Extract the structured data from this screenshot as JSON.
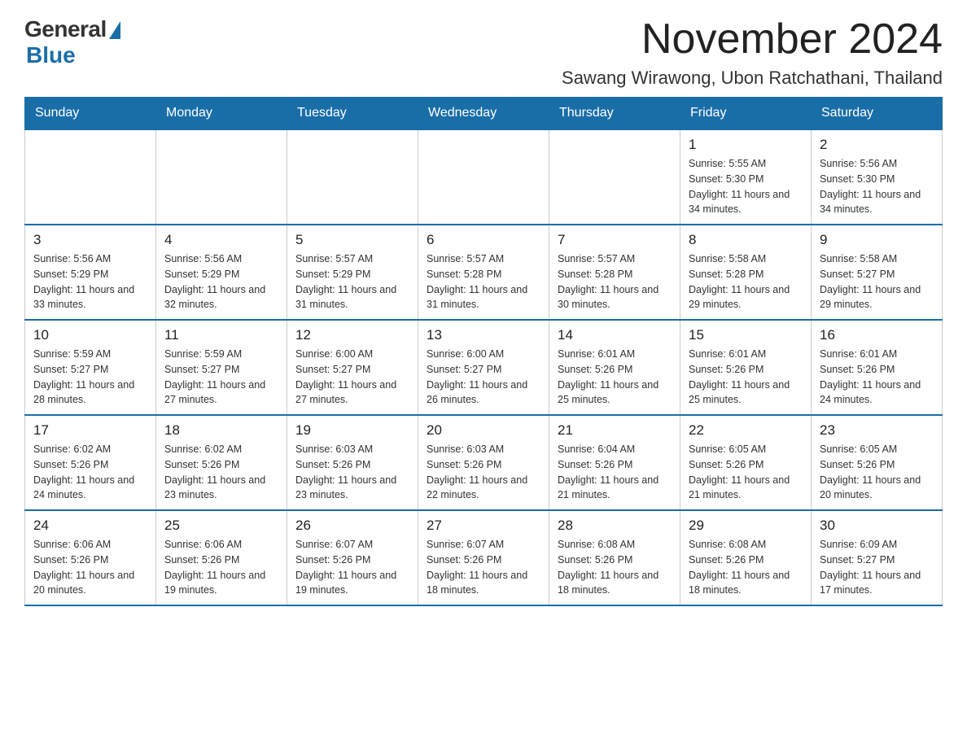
{
  "logo": {
    "general": "General",
    "blue": "Blue"
  },
  "title": "November 2024",
  "location": "Sawang Wirawong, Ubon Ratchathani, Thailand",
  "headers": [
    "Sunday",
    "Monday",
    "Tuesday",
    "Wednesday",
    "Thursday",
    "Friday",
    "Saturday"
  ],
  "weeks": [
    [
      {
        "day": "",
        "info": ""
      },
      {
        "day": "",
        "info": ""
      },
      {
        "day": "",
        "info": ""
      },
      {
        "day": "",
        "info": ""
      },
      {
        "day": "",
        "info": ""
      },
      {
        "day": "1",
        "info": "Sunrise: 5:55 AM\nSunset: 5:30 PM\nDaylight: 11 hours and 34 minutes."
      },
      {
        "day": "2",
        "info": "Sunrise: 5:56 AM\nSunset: 5:30 PM\nDaylight: 11 hours and 34 minutes."
      }
    ],
    [
      {
        "day": "3",
        "info": "Sunrise: 5:56 AM\nSunset: 5:29 PM\nDaylight: 11 hours and 33 minutes."
      },
      {
        "day": "4",
        "info": "Sunrise: 5:56 AM\nSunset: 5:29 PM\nDaylight: 11 hours and 32 minutes."
      },
      {
        "day": "5",
        "info": "Sunrise: 5:57 AM\nSunset: 5:29 PM\nDaylight: 11 hours and 31 minutes."
      },
      {
        "day": "6",
        "info": "Sunrise: 5:57 AM\nSunset: 5:28 PM\nDaylight: 11 hours and 31 minutes."
      },
      {
        "day": "7",
        "info": "Sunrise: 5:57 AM\nSunset: 5:28 PM\nDaylight: 11 hours and 30 minutes."
      },
      {
        "day": "8",
        "info": "Sunrise: 5:58 AM\nSunset: 5:28 PM\nDaylight: 11 hours and 29 minutes."
      },
      {
        "day": "9",
        "info": "Sunrise: 5:58 AM\nSunset: 5:27 PM\nDaylight: 11 hours and 29 minutes."
      }
    ],
    [
      {
        "day": "10",
        "info": "Sunrise: 5:59 AM\nSunset: 5:27 PM\nDaylight: 11 hours and 28 minutes."
      },
      {
        "day": "11",
        "info": "Sunrise: 5:59 AM\nSunset: 5:27 PM\nDaylight: 11 hours and 27 minutes."
      },
      {
        "day": "12",
        "info": "Sunrise: 6:00 AM\nSunset: 5:27 PM\nDaylight: 11 hours and 27 minutes."
      },
      {
        "day": "13",
        "info": "Sunrise: 6:00 AM\nSunset: 5:27 PM\nDaylight: 11 hours and 26 minutes."
      },
      {
        "day": "14",
        "info": "Sunrise: 6:01 AM\nSunset: 5:26 PM\nDaylight: 11 hours and 25 minutes."
      },
      {
        "day": "15",
        "info": "Sunrise: 6:01 AM\nSunset: 5:26 PM\nDaylight: 11 hours and 25 minutes."
      },
      {
        "day": "16",
        "info": "Sunrise: 6:01 AM\nSunset: 5:26 PM\nDaylight: 11 hours and 24 minutes."
      }
    ],
    [
      {
        "day": "17",
        "info": "Sunrise: 6:02 AM\nSunset: 5:26 PM\nDaylight: 11 hours and 24 minutes."
      },
      {
        "day": "18",
        "info": "Sunrise: 6:02 AM\nSunset: 5:26 PM\nDaylight: 11 hours and 23 minutes."
      },
      {
        "day": "19",
        "info": "Sunrise: 6:03 AM\nSunset: 5:26 PM\nDaylight: 11 hours and 23 minutes."
      },
      {
        "day": "20",
        "info": "Sunrise: 6:03 AM\nSunset: 5:26 PM\nDaylight: 11 hours and 22 minutes."
      },
      {
        "day": "21",
        "info": "Sunrise: 6:04 AM\nSunset: 5:26 PM\nDaylight: 11 hours and 21 minutes."
      },
      {
        "day": "22",
        "info": "Sunrise: 6:05 AM\nSunset: 5:26 PM\nDaylight: 11 hours and 21 minutes."
      },
      {
        "day": "23",
        "info": "Sunrise: 6:05 AM\nSunset: 5:26 PM\nDaylight: 11 hours and 20 minutes."
      }
    ],
    [
      {
        "day": "24",
        "info": "Sunrise: 6:06 AM\nSunset: 5:26 PM\nDaylight: 11 hours and 20 minutes."
      },
      {
        "day": "25",
        "info": "Sunrise: 6:06 AM\nSunset: 5:26 PM\nDaylight: 11 hours and 19 minutes."
      },
      {
        "day": "26",
        "info": "Sunrise: 6:07 AM\nSunset: 5:26 PM\nDaylight: 11 hours and 19 minutes."
      },
      {
        "day": "27",
        "info": "Sunrise: 6:07 AM\nSunset: 5:26 PM\nDaylight: 11 hours and 18 minutes."
      },
      {
        "day": "28",
        "info": "Sunrise: 6:08 AM\nSunset: 5:26 PM\nDaylight: 11 hours and 18 minutes."
      },
      {
        "day": "29",
        "info": "Sunrise: 6:08 AM\nSunset: 5:26 PM\nDaylight: 11 hours and 18 minutes."
      },
      {
        "day": "30",
        "info": "Sunrise: 6:09 AM\nSunset: 5:27 PM\nDaylight: 11 hours and 17 minutes."
      }
    ]
  ]
}
